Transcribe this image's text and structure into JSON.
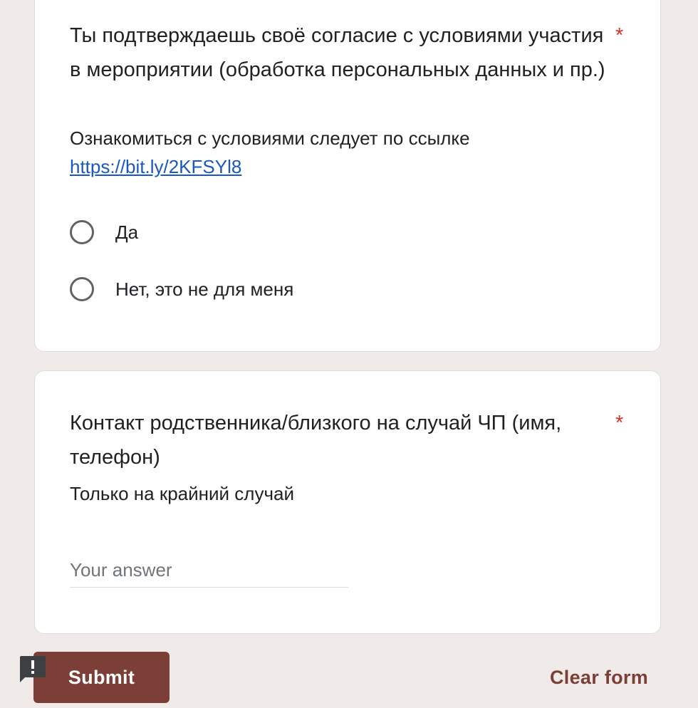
{
  "question1": {
    "title": "Ты подтверждаешь своё согласие с условиями участия в мероприятии (обработка персональных данных и пр.)",
    "required_mark": "*",
    "description_text": "Ознакомиться с условиями следует по ссылке",
    "description_link": "https://bit.ly/2KFSYl8",
    "options": [
      {
        "label": "Да",
        "selected": false
      },
      {
        "label": "Нет, это не для меня",
        "selected": false
      }
    ]
  },
  "question2": {
    "title": "Контакт родственника/близкого на случай ЧП (имя, телефон)",
    "required_mark": "*",
    "description_text": "Только на крайний случай",
    "answer_placeholder": "Your answer",
    "answer_value": ""
  },
  "footer": {
    "submit_label": "Submit",
    "clear_label": "Clear form",
    "report_icon": "report-issue-icon"
  },
  "colors": {
    "background": "#f0ebe8",
    "accent": "#7b3f37",
    "required": "#d93025",
    "link": "#1a57c4"
  }
}
